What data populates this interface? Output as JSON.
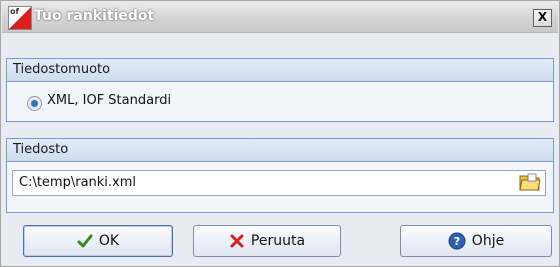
{
  "window": {
    "title": "Tuo rankitiedot",
    "icon_text": "of",
    "close_label": "X"
  },
  "format_group": {
    "header": "Tiedostomuoto",
    "option_label": "XML, IOF Standardi",
    "option_selected": true
  },
  "file_group": {
    "header": "Tiedosto",
    "path_value": "C:\\temp\\ranki.xml"
  },
  "buttons": {
    "ok_label": "OK",
    "cancel_label": "Peruuta",
    "help_label": "Ohje"
  },
  "colors": {
    "accent_border": "#7a9acd",
    "ok_check": "#3a8a1e",
    "cancel_x": "#d42020",
    "help_icon": "#2f5fb0"
  }
}
